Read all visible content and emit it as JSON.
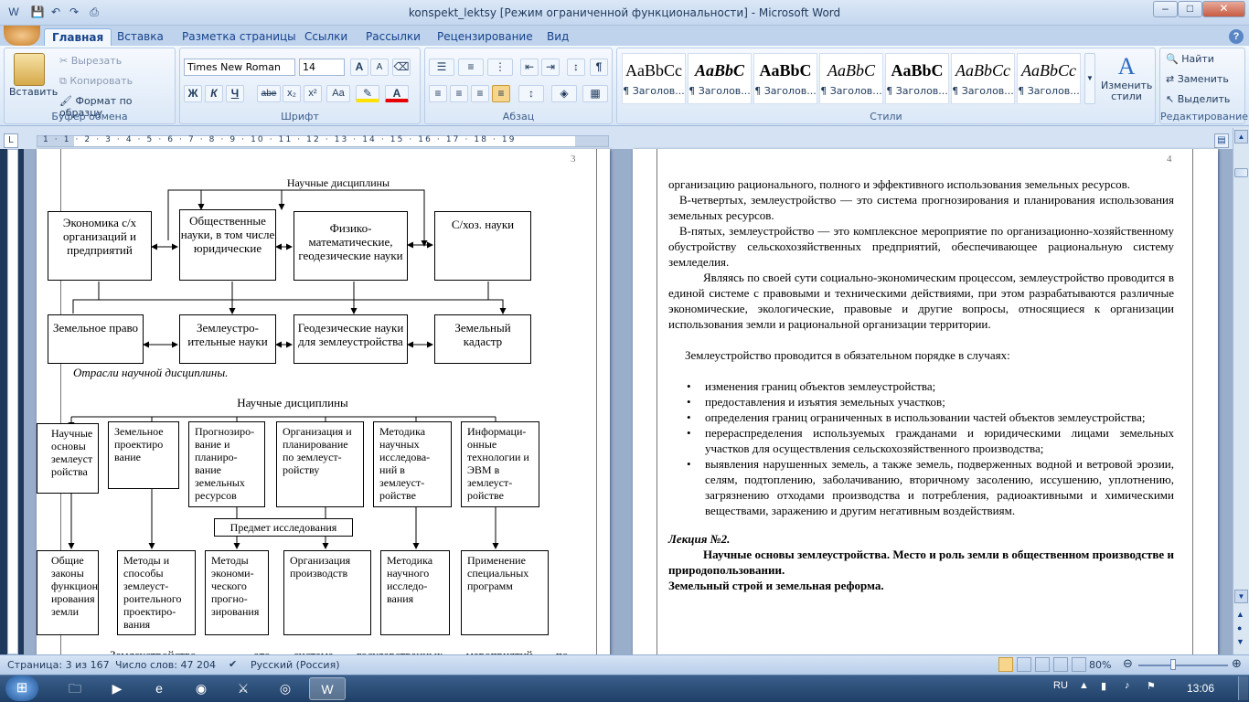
{
  "window": {
    "title": "konspekt_lektsy [Режим ограниченной функциональности] - Microsoft Word",
    "min": "–",
    "max": "□",
    "close": "✕"
  },
  "tabs": [
    "Главная",
    "Вставка",
    "Разметка страницы",
    "Ссылки",
    "Рассылки",
    "Рецензирование",
    "Вид"
  ],
  "clipboard": {
    "paste": "Вставить",
    "cut": "Вырезать",
    "copy": "Копировать",
    "format_painter": "Формат по образцу",
    "group": "Буфер обмена"
  },
  "font": {
    "name": "Times New Roman",
    "size": "14",
    "group": "Шрифт",
    "bold": "Ж",
    "italic": "К",
    "underline": "Ч",
    "strike": "abe",
    "sub": "x₂",
    "sup": "x²",
    "case": "Aa",
    "grow": "A",
    "shrink": "A"
  },
  "paragraph": {
    "group": "Абзац",
    "marks": "¶"
  },
  "styles": {
    "group": "Стили",
    "change": "Изменить стили",
    "items": [
      {
        "sample": "AaBbCc",
        "name": "¶ Заголов..."
      },
      {
        "sample": "AaBbC",
        "name": "¶ Заголов..."
      },
      {
        "sample": "AaBbC",
        "name": "¶ Заголов..."
      },
      {
        "sample": "AaBbC",
        "name": "¶ Заголов..."
      },
      {
        "sample": "AaBbC",
        "name": "¶ Заголов..."
      },
      {
        "sample": "AaBbCc",
        "name": "¶ Заголов..."
      },
      {
        "sample": "AaBbCc",
        "name": "¶ Заголов..."
      }
    ]
  },
  "editing": {
    "group": "Редактирование",
    "find": "Найти",
    "replace": "Заменить",
    "select": "Выделить"
  },
  "ruler": {
    "marks": "1 · 1 · 2 · 3 · 4 · 5 · 6 · 7 · 8 · 9 · 10 · 11 · 12 · 13 · 14 · 15 · 16 · 17 · 18 · 19"
  },
  "page3": {
    "num": "3",
    "d1": {
      "title": "Научные дисциплины",
      "boxes": [
        "Экономика с/х организаций и предприятий",
        "Общественные науки, в том числе юридические",
        "Физико-математические, геодезические науки",
        "С/хоз. науки"
      ],
      "branches": [
        "Земельное право",
        "Землеустро-ительные науки",
        "Геодезические науки для землеустройства",
        "Земельный кадастр"
      ],
      "caption": "Отрасли научной дисциплины."
    },
    "d2": {
      "title": "Научные дисциплины",
      "top": [
        "Научные основы землеуст ройства",
        "Земельное проектиро вание",
        "Прогнозиро-вание и планиро-вание земельных ресурсов",
        "Организация и планирование по землеуст-ройству",
        "Методика научных исследова-ний в землеуст-ройстве",
        "Информаци-онные технологии и ЭВМ в землеуст-ройстве"
      ],
      "subject": "Предмет исследования",
      "bottom": [
        "Общие законы функцион ирования земли",
        "Методы и способы землеуст-роительного проектиро-вания",
        "Методы экономи-ческого прогно-зирования",
        "Организация производств",
        "Методика научного исследо-вания",
        "Применение специальных программ"
      ]
    },
    "footer_line": "Землеустройство — это система государственных мероприятий по"
  },
  "page4": {
    "num": "4",
    "p1": "организацию рационального, полного и эффективного использования земельных ресурсов.",
    "p2": "В-четвертых, землеустройство — это система прогнозирования и планирования использования земельных ресурсов.",
    "p3": "В-пятых, землеустройство — это комплексное мероприятие по организационно-хозяйственному обустройству сельскохозяйственных предприятий, обеспечивающее рациональную систему земледелия.",
    "p4": "Являясь по своей сути социально-экономическим процессом, землеустройство проводится в единой системе с правовыми и техническими действиями, при этом разрабатываются различные экономические, экологические, правовые и другие вопросы, относящиеся к организации использования земли и рациональной организации территории.",
    "p5": "Землеустройство проводится в обязательном порядке в случаях:",
    "bullets": [
      "изменения границ объектов землеустройства;",
      "предоставления и изъятия земельных участков;",
      "определения границ ограниченных в использовании частей объектов землеустройства;",
      "перераспределения используемых гражданами и юридическими лицами земельных участков для осуществления сельскохозяйственного производства;",
      "выявления нарушенных земель, а также земель, подверженных водной и ветровой эрозии, селям, подтоплению, заболачиванию, вторичному засолению, иссушению, уплотнению, загрязнению отходами производства и потребления, радиоактивными и химическими веществами, заражению и другим негативным воздействиям."
    ],
    "lecture": "Лекция №2.",
    "heading": "Научные основы землеустройства. Место и роль земли в общественном производстве и природопользовании.",
    "heading2": "Земельный строй и земельная реформа."
  },
  "status": {
    "page": "Страница: 3 из 167",
    "words": "Число слов: 47 204",
    "lang": "Русский (Россия)",
    "zoom": "80%"
  },
  "taskbar": {
    "lang": "RU",
    "time": "13:06"
  }
}
